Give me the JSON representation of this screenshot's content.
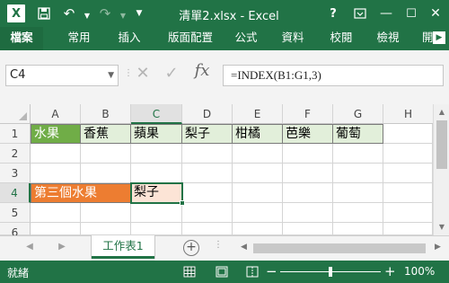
{
  "window": {
    "title": "清單2.xlsx - Excel"
  },
  "ribbon": {
    "tabs": [
      "檔案",
      "常用",
      "插入",
      "版面配置",
      "公式",
      "資料",
      "校閱",
      "檢視",
      "開"
    ]
  },
  "formula_bar": {
    "name_box": "C4",
    "fx_label": "fx",
    "formula": "=INDEX(B1:G1,3)"
  },
  "grid": {
    "columns": [
      "A",
      "B",
      "C",
      "D",
      "E",
      "F",
      "G",
      "H"
    ],
    "rows": [
      "1",
      "2",
      "3",
      "4",
      "5",
      "6"
    ],
    "selected_cell": "C4",
    "cells": {
      "A1": "水果",
      "B1": "香蕉",
      "C1": "蘋果",
      "D1": "梨子",
      "E1": "柑橘",
      "F1": "芭樂",
      "G1": "葡萄",
      "A4": "第三個水果",
      "C4": "梨子"
    }
  },
  "sheets": {
    "tabs": [
      "工作表1"
    ],
    "active": "工作表1"
  },
  "status_bar": {
    "status": "就緒",
    "zoom": "100%"
  },
  "colors": {
    "accent": "#217346",
    "header_fill": "#70ad47",
    "row_fill": "#e2efda",
    "label_fill": "#ed7d31",
    "result_fill": "#fce4d6"
  },
  "icons": [
    "excel-logo-icon",
    "save-icon",
    "undo-icon",
    "redo-icon",
    "customize-qat-icon",
    "help-icon",
    "ribbon-display-options-icon",
    "minimize-icon",
    "maximize-icon",
    "close-icon",
    "cancel-icon",
    "enter-icon",
    "insert-function-icon",
    "add-sheet-icon",
    "normal-view-icon",
    "page-layout-icon",
    "page-break-preview-icon",
    "zoom-out-icon",
    "zoom-in-icon"
  ]
}
